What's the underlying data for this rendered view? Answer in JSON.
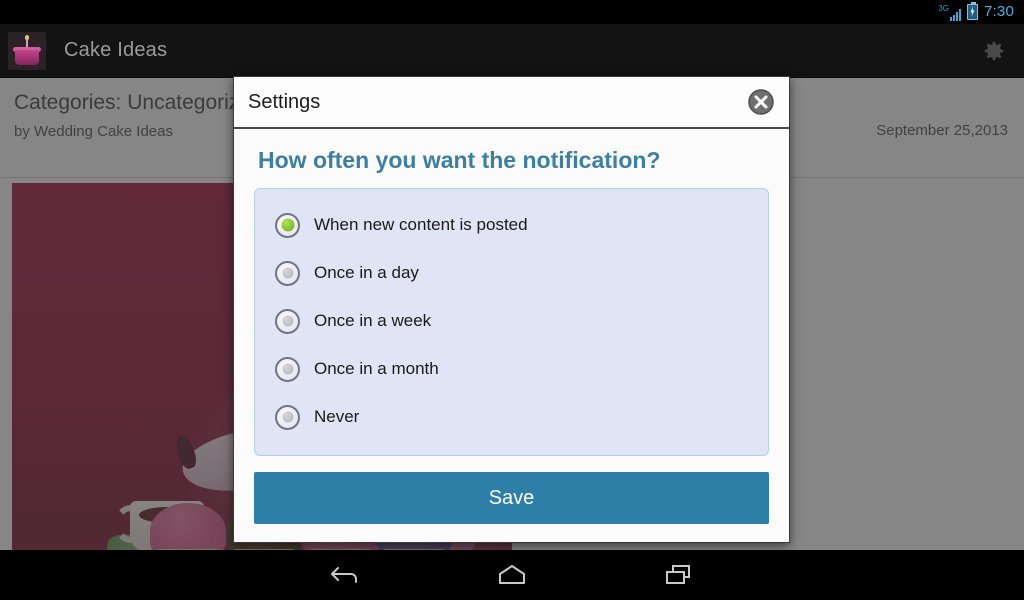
{
  "status_bar": {
    "network_label": "3G",
    "time": "7:30",
    "signal_icon": "signal-bars-icon",
    "battery_icon": "battery-charging-icon",
    "accent_color": "#45b3e0"
  },
  "action_bar": {
    "app_icon": "cake-icon",
    "title": "Cake Ideas",
    "settings_icon": "gear-icon",
    "background_color": "#131313",
    "title_color": "#9b9b9b"
  },
  "content": {
    "categories": "Categories:  Uncategoriz",
    "author": "by Wedding Cake Ideas",
    "date": "September 25,2013",
    "image_alt": "teapot-shaped-cake-with-cupcakes"
  },
  "dialog": {
    "title": "Settings",
    "close_icon": "close-circle-icon",
    "heading": "How often you want the notification?",
    "heading_color": "#3b7fa4",
    "group_background": "#e0e5f6",
    "options": [
      {
        "label": "When new content is posted",
        "selected": true
      },
      {
        "label": "Once in a day",
        "selected": false
      },
      {
        "label": "Once in a week",
        "selected": false
      },
      {
        "label": "Once in a month",
        "selected": false
      },
      {
        "label": "Never",
        "selected": false
      }
    ],
    "selected_dot_color": "#7db52a",
    "save_label": "Save",
    "save_color": "#2e7fa8"
  },
  "nav_bar": {
    "back_icon": "back-arrow-icon",
    "home_icon": "home-icon",
    "recents_icon": "recent-apps-icon"
  }
}
